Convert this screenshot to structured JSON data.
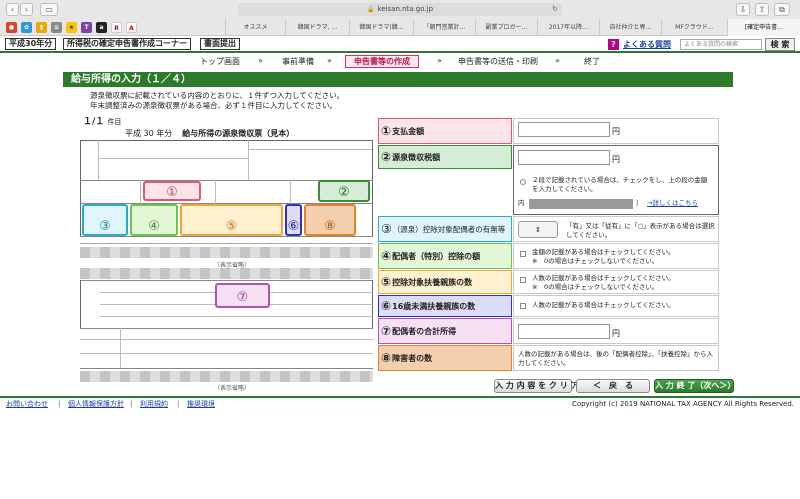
{
  "browser": {
    "url": "keisan.nta.go.jp",
    "tabs": [
      "オススメ",
      "韓国ドラマ, …",
      "韓国ドラマ(韓…",
      "「朝門営業計…",
      "副業ブロガー…",
      "2017年以降…",
      "自社仲介と専…",
      "MFクラウド…",
      "[確定申告書…"
    ]
  },
  "header": {
    "year_label": "平成30年分",
    "corner_label": "所得税の確定申告書作成コーナー",
    "submit_label": "書面提出",
    "faq": "よくある質問",
    "search_placeholder": "よくある質問の検索",
    "search_button": "検 索"
  },
  "steps": [
    "トップ画面",
    "事前準備",
    "申告書等の作成",
    "申告書等の送信・印刷",
    "終了"
  ],
  "title": "給与所得の入力（１／４）",
  "instructions": [
    "源泉徴収票に記載されている内容のとおりに、１件ずつ入力してください。",
    "年末調整済みの源泉徴収票がある場合、必ず１件目に入力してください。"
  ],
  "count": {
    "main": "１/１",
    "unit": "件目"
  },
  "slip": {
    "era": "平成 30 年分",
    "name": "給与所得の源泉徴収票（見本）",
    "omitted": "（表示省略）",
    "markers": [
      "①",
      "②",
      "③",
      "④",
      "⑤",
      "⑥",
      "⑧",
      "⑦"
    ]
  },
  "form": {
    "rows": [
      {
        "num": "①",
        "label": "支払金額",
        "unit": "円"
      },
      {
        "num": "②",
        "label": "源泉徴収税額",
        "unit": "円",
        "note": "２段で記載されている場合は、チェックをし、上の段の金額を入力してください。",
        "inner_prefix": "内（",
        "detail": "→詳しくはこちら"
      },
      {
        "num": "③",
        "label": "（源泉）控除対象配偶者の有無等",
        "note": "「有」又は「従有」に「○」表示がある場合は選択してください。"
      },
      {
        "num": "④",
        "label": "配偶者（特別）控除の額",
        "note": "金額の記載がある場合はチェックしてください。",
        "note2": "※　0の場合はチェックしないでください。"
      },
      {
        "num": "⑤",
        "label": "控除対象扶養親族の数",
        "note": "人数の記載がある場合はチェックしてください。",
        "note2": "※　0の場合はチェックしないでください。"
      },
      {
        "num": "⑥",
        "label": "16歳未満扶養親族の数",
        "note": "人数の記載がある場合はチェックしてください。"
      },
      {
        "num": "⑦",
        "label": "配偶者の合計所得",
        "unit": "円"
      },
      {
        "num": "⑧",
        "label": "障害者の数",
        "note": "人数の記載がある場合は、後の「配偶者控除」、「扶養控除」から入力してください。"
      }
    ]
  },
  "buttons": {
    "clear": "入 力 内 容 を ク リ ア",
    "back": "＜　戻　る",
    "next": "入 力 終 了（次へ＞）"
  },
  "footer": {
    "links": [
      "お問い合わせ",
      "個人情報保護方針",
      "利用規約",
      "推奨環境"
    ],
    "copyright": "Copyright (c) 2019 NATIONAL TAX AGENCY All Rights Reserved."
  },
  "colors": {
    "green": "#2d7a2d",
    "r1": "#fde4e8",
    "r2": "#d5ecd5",
    "r3": "#dff4fb",
    "r4": "#e3f6d6",
    "r5": "#fff0cf",
    "r6": "#dcdcf6",
    "r7": "#f6e1f4",
    "r8": "#f4cfae"
  }
}
